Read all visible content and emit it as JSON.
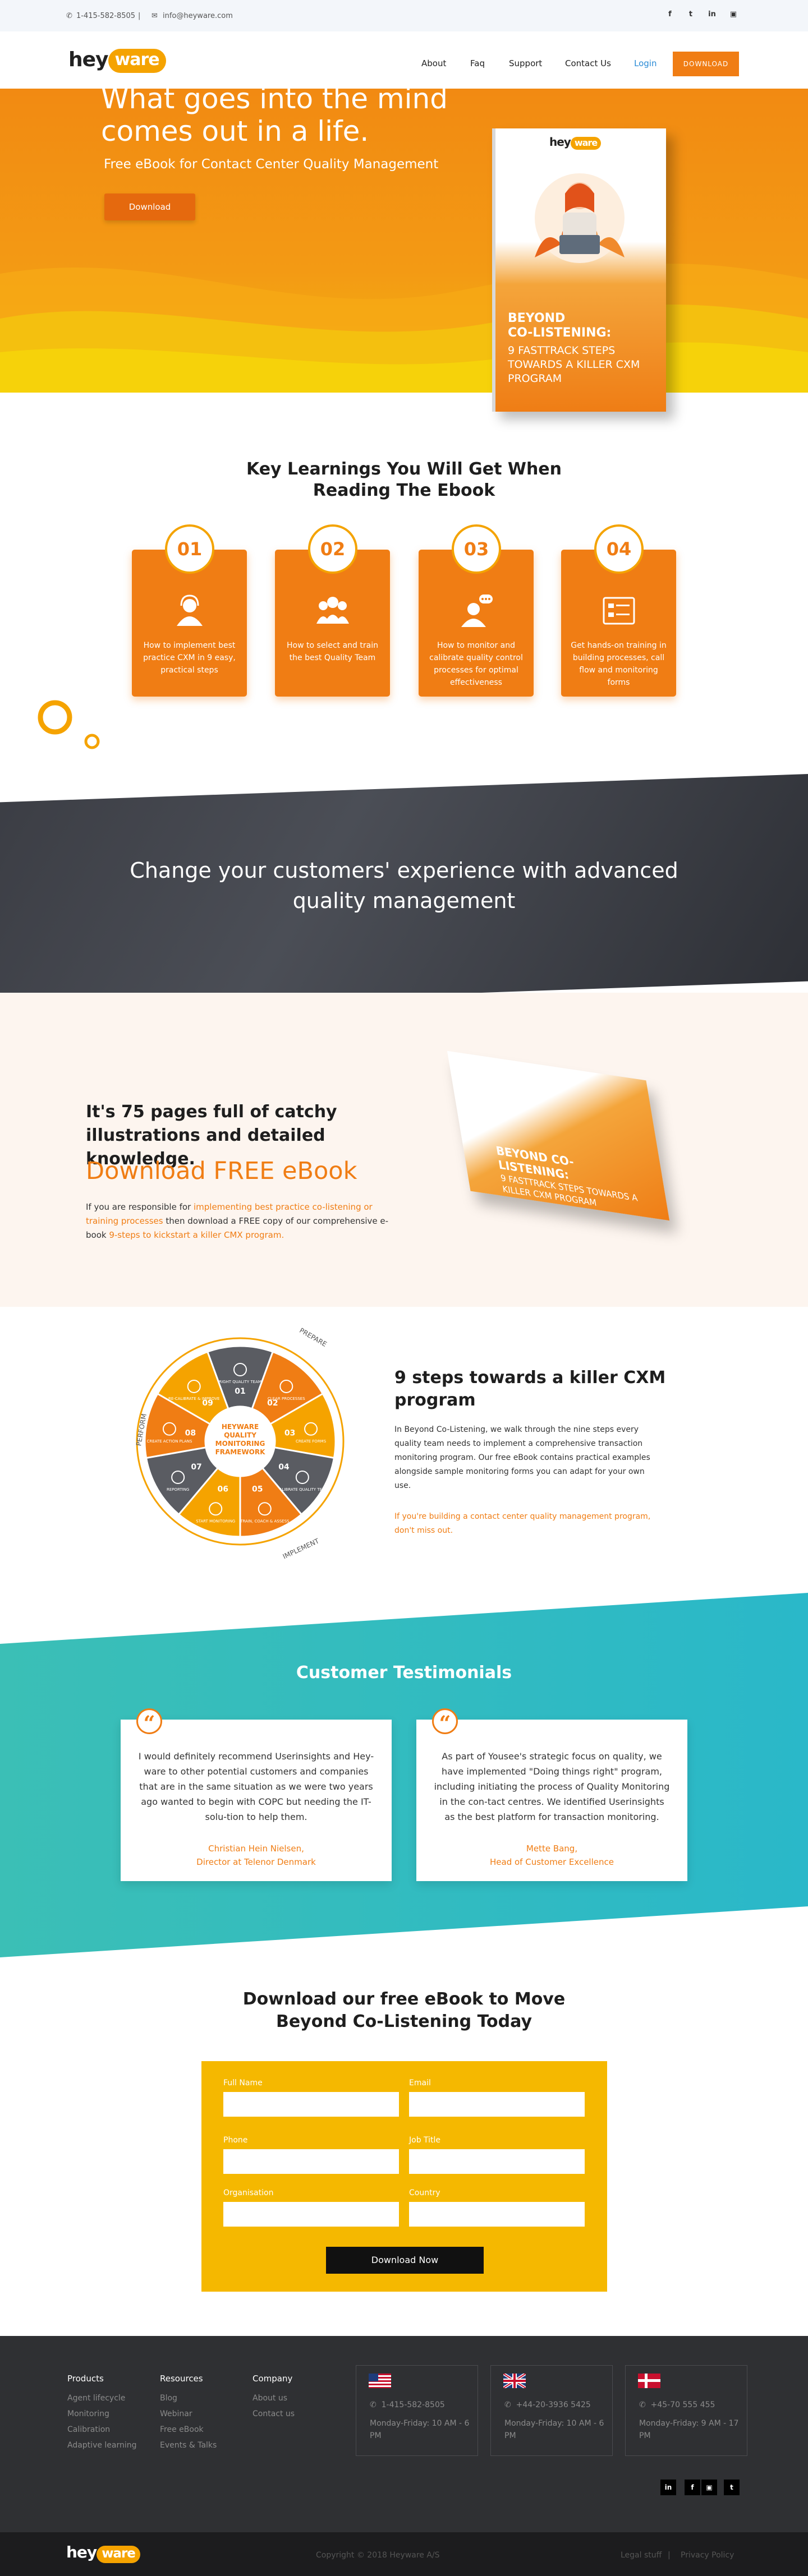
{
  "topbar": {
    "phone": "1-415-582-8505",
    "email": "info@heyware.com",
    "social": [
      "facebook-icon",
      "twitter-icon",
      "linkedin-icon",
      "instagram-icon"
    ]
  },
  "nav": {
    "logo_hey": "hey",
    "logo_ware": "ware",
    "links": [
      "About",
      "Faq",
      "Support",
      "Contact Us"
    ],
    "login": "Login",
    "download": "DOWNLOAD"
  },
  "hero": {
    "title": "What goes into the mind comes out in a life.",
    "subtitle": "Free eBook for Contact Center Quality Management",
    "button": "Download",
    "book": {
      "brand_hey": "hey",
      "brand_ware": "ware",
      "title_line1": "BEYOND",
      "title_line2": "CO-LISTENING:",
      "subtitle": "9 FASTTRACK STEPS TOWARDS A KILLER CXM PROGRAM"
    }
  },
  "learnings": {
    "title": "Key Learnings You Will Get When Reading The Ebook",
    "cards": [
      {
        "num": "01",
        "icon": "agent-icon",
        "text": "How to implement best practice CXM in 9 easy, practical steps"
      },
      {
        "num": "02",
        "icon": "team-icon",
        "text": "How to select and train the best Quality Team"
      },
      {
        "num": "03",
        "icon": "monitor-icon",
        "text": "How to monitor and calibrate quality control processes for optimal effectiveness"
      },
      {
        "num": "04",
        "icon": "form-icon",
        "text": "Get hands-on training in building processes, call flow and monitoring forms"
      }
    ]
  },
  "banner": {
    "text": "Change your customers' experience with advanced quality management"
  },
  "pages": {
    "heading": "It's 75 pages full of catchy illustrations and detailed knowledge.",
    "download": "Download FREE eBook",
    "p1": "If you are responsible for ",
    "p1_hl": "implementing best practice co-listening or training processes",
    "p2": " then download a FREE copy of our comprehensive e-book ",
    "p2_hl": "9-steps to kickstart a killer CMX program."
  },
  "steps": {
    "heading": "9 steps towards a killer CXM program",
    "body": "In Beyond Co-Listening, we walk through the nine steps every quality team needs to implement a comprehensive transaction monitoring program. Our free eBook contains practical examples alongside sample monitoring forms you can adapt for your own use.",
    "highlight": "If you're building a contact center quality management program, don't miss out.",
    "wheel": {
      "center": [
        "HEYWARE",
        "QUALITY",
        "MONITORING",
        "FRAMEWORK"
      ],
      "segments": [
        {
          "n": "01",
          "label": "RIGHT QUALITY TEAM"
        },
        {
          "n": "02",
          "label": "CLEAR PROCESSES"
        },
        {
          "n": "03",
          "label": "CREATE FORMS"
        },
        {
          "n": "04",
          "label": "CALIBRATE QUALITY TEAM"
        },
        {
          "n": "05",
          "label": "TRAIN, COACH & ASSESS"
        },
        {
          "n": "06",
          "label": "START MONITORING"
        },
        {
          "n": "07",
          "label": "REPORTING"
        },
        {
          "n": "08",
          "label": "CREATE ACTION PLANS"
        },
        {
          "n": "09",
          "label": "RE-CALIBRATE & IMPROVE"
        }
      ],
      "arc_labels": [
        "PREPARE",
        "IMPLEMENT",
        "PERFORM"
      ]
    }
  },
  "testimonials": {
    "title": "Customer Testimonials",
    "items": [
      {
        "text": "I would definitely recommend Userinsights and Hey-ware to other potential customers and companies that are in the same situation as we were two years ago wanted to begin with COPC but needing the IT-solu-tion to help them.",
        "name": "Christian Hein Nielsen,",
        "role": "Director at Telenor Denmark"
      },
      {
        "text": "As part of Yousee's strategic focus on quality, we have implemented \"Doing things right\" program, including initiating the process of Quality Monitoring in the con-tact centres. We identified Userinsights as the best platform for transaction monitoring.",
        "name": "Mette Bang,",
        "role": "Head of Customer Excellence"
      }
    ]
  },
  "form": {
    "title": "Download our free eBook to Move Beyond Co-Listening Today",
    "fields": [
      "Full Name",
      "Email",
      "Phone",
      "Job Title",
      "Organisation",
      "Country"
    ],
    "submit": "Download Now"
  },
  "footer": {
    "cols": [
      {
        "title": "Products",
        "links": [
          "Agent lifecycle",
          "Monitoring",
          "Calibration",
          "Adaptive learning"
        ]
      },
      {
        "title": "Resources",
        "links": [
          "Blog",
          "Webinar",
          "Free eBook",
          "Events & Talks"
        ]
      },
      {
        "title": "Company",
        "links": [
          "About us",
          "Contact us"
        ]
      }
    ],
    "offices": [
      {
        "flag": "us-flag-icon",
        "phone": "1-415-582-8505",
        "hours": "Monday-Friday: 10 AM - 6 PM"
      },
      {
        "flag": "uk-flag-icon",
        "phone": "+44-20-3936 5425",
        "hours": "Monday-Friday: 10 AM - 6 PM"
      },
      {
        "flag": "dk-flag-icon",
        "phone": "+45-70 555 455",
        "hours": "Monday-Friday: 9 AM - 17 PM"
      }
    ],
    "social": [
      "linkedin-icon",
      "facebook-icon",
      "instagram-icon",
      "twitter-icon"
    ],
    "copyright": "Copyright © 2018 Heyware A/S",
    "legal": "Legal stuff",
    "privacy": "Privacy Policy"
  },
  "colors": {
    "orange": "#f07d14",
    "yellow": "#f5b800",
    "teal": "#2ab8c9",
    "dark": "#2f3033"
  }
}
